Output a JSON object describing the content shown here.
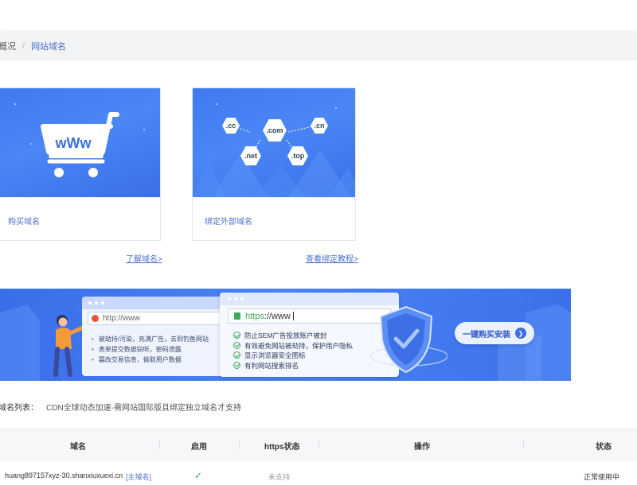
{
  "breadcrumb": {
    "prev": "概况",
    "separator": "/",
    "current": "网站域名"
  },
  "cards": [
    {
      "label": "购买域名",
      "link": "了解域名>"
    },
    {
      "label": "绑定外部域名",
      "link": "查看绑定教程>",
      "tlds": [
        ".cc",
        ".com",
        ".cn",
        ".net",
        ".top"
      ]
    }
  ],
  "banner": {
    "bad_url": "http://www",
    "bad_points": [
      "被劫持/污染，充满广告，去到钓鱼网站",
      "表单提交数据窃听，密码泄露",
      "篡改交易信息，偷取用户数据"
    ],
    "good_url_scheme": "https",
    "good_url_rest": "://www",
    "good_points": [
      "防止SEM广告投放账户被封",
      "有效避免网站被劫持，保护用户隐私",
      "显示浏览器安全图标",
      "有利网站搜索排名"
    ],
    "cta": "一键购买安装"
  },
  "domain_list": {
    "label": "域名列表：",
    "note": "CDN全球动态加速-需网站国际版且绑定独立域名才支持"
  },
  "table": {
    "headers": [
      "域名",
      "启用",
      "https状态",
      "操作",
      "状态"
    ],
    "row": {
      "domain": "huang897157xyz-30.shanxiuxuexi.cn",
      "tag": "[主域名]",
      "https": "未支持",
      "status": "正常使用中"
    }
  },
  "colors": {
    "accent": "#4a6fcc",
    "banner": "#3f78ef",
    "check": "#3fa75a"
  }
}
